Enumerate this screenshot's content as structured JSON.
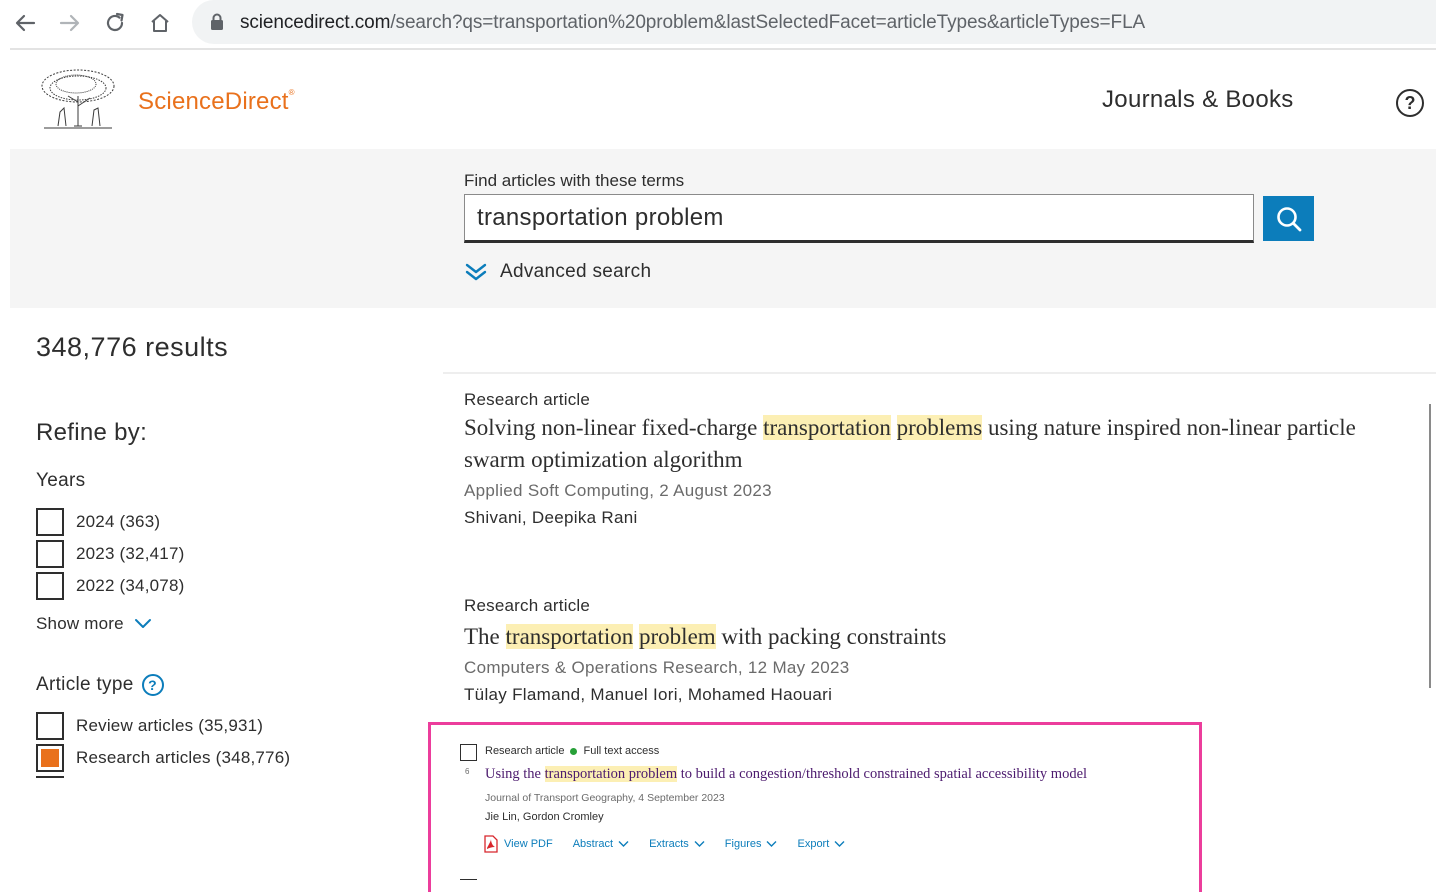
{
  "browser": {
    "url_host": "sciencedirect.com",
    "url_path": "/search?qs=transportation%20problem&lastSelectedFacet=articleTypes&articleTypes=FLA"
  },
  "header": {
    "brand": "ScienceDirect",
    "journals_books": "Journals & Books",
    "help": "?"
  },
  "search": {
    "label": "Find articles with these terms",
    "value": "transportation problem",
    "advanced": "Advanced search"
  },
  "sidebar": {
    "results_count": "348,776 results",
    "refine_by": "Refine by:",
    "years_title": "Years",
    "years": [
      {
        "label": "2024 (363)",
        "checked": false
      },
      {
        "label": "2023 (32,417)",
        "checked": false
      },
      {
        "label": "2022 (34,078)",
        "checked": false
      }
    ],
    "show_more": "Show more",
    "article_type_title": "Article type",
    "article_type_help": "?",
    "article_types": [
      {
        "label": "Review articles (35,931)",
        "checked": false
      },
      {
        "label": "Research articles (348,776)",
        "checked": true
      }
    ]
  },
  "results": [
    {
      "type": "Research article",
      "title_parts": [
        "Solving non-linear fixed-charge ",
        "transportation",
        " ",
        "problems",
        " using nature inspired non-linear particle swarm optimization algorithm"
      ],
      "source": "Applied Soft Computing, 2 August 2023",
      "authors": "Shivani, Deepika Rani"
    },
    {
      "type": "Research article",
      "title_parts": [
        "The ",
        "transportation",
        " ",
        "problem",
        " with packing constraints"
      ],
      "source": "Computers & Operations Research, 12 May 2023",
      "authors": "Tülay Flamand, Manuel Iori, Mohamed Haouari"
    }
  ],
  "inset": {
    "type": "Research article",
    "access": "Full text access",
    "index": "6",
    "title_parts": [
      "Using the ",
      "transportation problem",
      " to build a congestion/threshold constrained spatial accessibility model"
    ],
    "source": "Journal of Transport Geography, 4 September 2023",
    "authors": "Jie Lin, Gordon Cromley",
    "actions": [
      "View PDF",
      "Abstract",
      "Extracts",
      "Figures",
      "Export"
    ]
  },
  "colors": {
    "brand_orange": "#e9711c",
    "link_blue": "#0c7dbb",
    "highlight": "#fcefb4",
    "inset_border": "#ec3d9c"
  }
}
